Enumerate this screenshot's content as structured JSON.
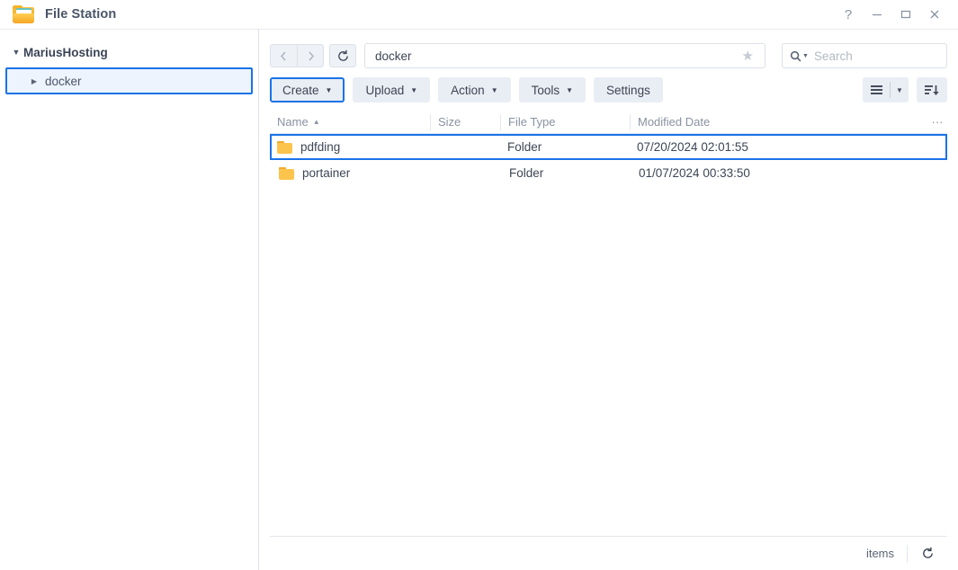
{
  "window": {
    "title": "File Station",
    "app_icon": "folder-icon",
    "controls": [
      {
        "name": "help-button",
        "glyph": "?"
      },
      {
        "name": "minimize-button",
        "glyph": "minimize-icon"
      },
      {
        "name": "maximize-button",
        "glyph": "maximize-icon"
      },
      {
        "name": "close-button",
        "glyph": "close-icon"
      }
    ]
  },
  "sidebar": {
    "root": {
      "label": "MariusHosting",
      "caret": "▼",
      "expanded": true
    },
    "child": {
      "label": "docker",
      "caret": "▶",
      "expanded": false,
      "selected": true
    }
  },
  "nav": {
    "back_icon": "chevron-left-icon",
    "forward_icon": "chevron-right-icon",
    "reload_icon": "refresh-icon",
    "path_value": "docker",
    "favorite_icon": "star-icon",
    "search_icon": "search-icon",
    "search_placeholder": "Search",
    "search_value": ""
  },
  "toolbar": {
    "buttons": [
      {
        "label": "Create",
        "has_dropdown": true,
        "highlighted": true
      },
      {
        "label": "Upload",
        "has_dropdown": true,
        "highlighted": false
      },
      {
        "label": "Action",
        "has_dropdown": true,
        "highlighted": false
      },
      {
        "label": "Tools",
        "has_dropdown": true,
        "highlighted": false
      },
      {
        "label": "Settings",
        "has_dropdown": false,
        "highlighted": false
      }
    ],
    "view_icon": "list-view-icon",
    "view_caret": "▼",
    "sort_icon": "sort-descending-icon"
  },
  "table": {
    "columns": [
      {
        "key": "name",
        "label": "Name",
        "sorted": "asc",
        "sort_glyph": "▲"
      },
      {
        "key": "size",
        "label": "Size"
      },
      {
        "key": "type",
        "label": "File Type"
      },
      {
        "key": "date",
        "label": "Modified Date"
      }
    ],
    "column_menu_icon": "more-vertical-icon",
    "rows": [
      {
        "icon": "folder-icon",
        "name": "pdfding",
        "size": "",
        "type": "Folder",
        "date": "07/20/2024 02:01:55",
        "selected": true
      },
      {
        "icon": "folder-icon",
        "name": "portainer",
        "size": "",
        "type": "Folder",
        "date": "01/07/2024 00:33:50",
        "selected": false
      }
    ]
  },
  "statusbar": {
    "items_label": "items",
    "refresh_icon": "refresh-icon"
  },
  "colors": {
    "accent": "#1a73e8",
    "folder": "#fcc44d",
    "toolbar_button_bg": "#e9edf4",
    "text": "#3d4654",
    "muted_text": "#8992a0"
  }
}
